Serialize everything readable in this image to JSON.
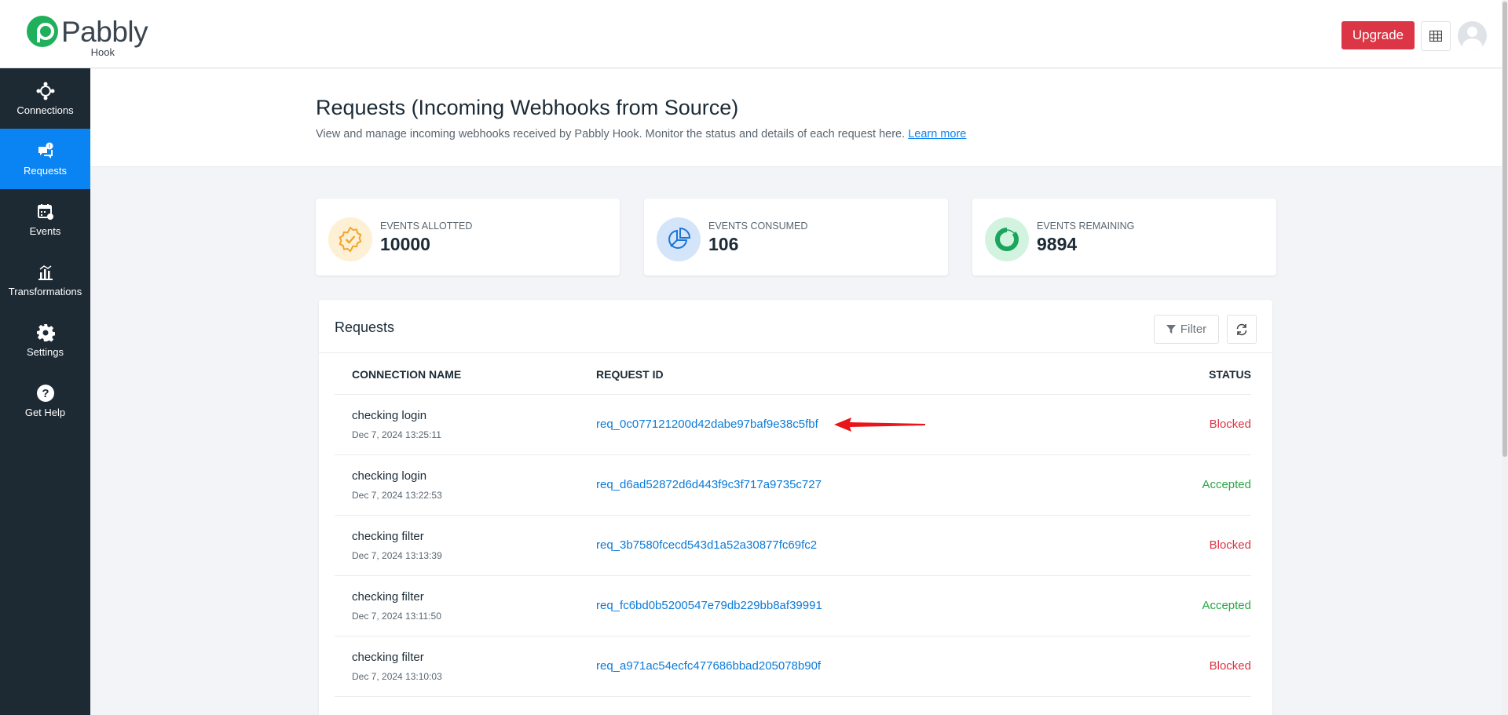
{
  "brand": {
    "name": "Pabbly",
    "product": "Hook",
    "color": "#20b05c"
  },
  "topbar": {
    "upgrade_label": "Upgrade",
    "apps_icon": "grid-icon",
    "avatar_icon": "user-avatar-icon"
  },
  "sidebar": {
    "items": [
      {
        "label": "Connections",
        "icon": "connections-icon",
        "active": false
      },
      {
        "label": "Requests",
        "icon": "requests-icon",
        "active": true
      },
      {
        "label": "Events",
        "icon": "calendar-icon",
        "active": false
      },
      {
        "label": "Transformations",
        "icon": "chart-icon",
        "active": false
      },
      {
        "label": "Settings",
        "icon": "gear-icon",
        "active": false
      },
      {
        "label": "Get Help",
        "icon": "help-icon",
        "active": false
      }
    ]
  },
  "header": {
    "title": "Requests (Incoming Webhooks from Source)",
    "description": "View and manage incoming webhooks received by Pabbly Hook. Monitor the status and details of each request here. ",
    "learn_more": "Learn more"
  },
  "stats": [
    {
      "label": "EVENTS ALLOTTED",
      "value": "10000",
      "icon": "badge-check-icon",
      "color": "#f0a62d"
    },
    {
      "label": "EVENTS CONSUMED",
      "value": "106",
      "icon": "pie-chart-icon",
      "color": "#1b75d8"
    },
    {
      "label": "EVENTS REMAINING",
      "value": "9894",
      "icon": "ring-chart-icon",
      "color": "#1aa65a"
    }
  ],
  "requests": {
    "title": "Requests",
    "filter_label": "Filter",
    "columns": {
      "connection": "CONNECTION NAME",
      "request_id": "REQUEST ID",
      "status": "STATUS"
    },
    "rows": [
      {
        "name": "checking login",
        "date": "Dec 7, 2024 13:25:11",
        "id": "req_0c077121200d42dabe97baf9e38c5fbf",
        "status": "Blocked"
      },
      {
        "name": "checking login",
        "date": "Dec 7, 2024 13:22:53",
        "id": "req_d6ad52872d6d443f9c3f717a9735c727",
        "status": "Accepted"
      },
      {
        "name": "checking filter",
        "date": "Dec 7, 2024 13:13:39",
        "id": "req_3b7580fcecd543d1a52a30877fc69fc2",
        "status": "Blocked"
      },
      {
        "name": "checking filter",
        "date": "Dec 7, 2024 13:11:50",
        "id": "req_fc6bd0b5200547e79db229bb8af39991",
        "status": "Accepted"
      },
      {
        "name": "checking filter",
        "date": "Dec 7, 2024 13:10:03",
        "id": "req_a971ac54ecfc477686bbad205078b90f",
        "status": "Blocked"
      }
    ]
  },
  "colors": {
    "accent": "#0b84f3",
    "sidebar": "#1e2a33",
    "blocked": "#dc3545",
    "accepted": "#28a745",
    "annotation_arrow": "#e8161b"
  }
}
